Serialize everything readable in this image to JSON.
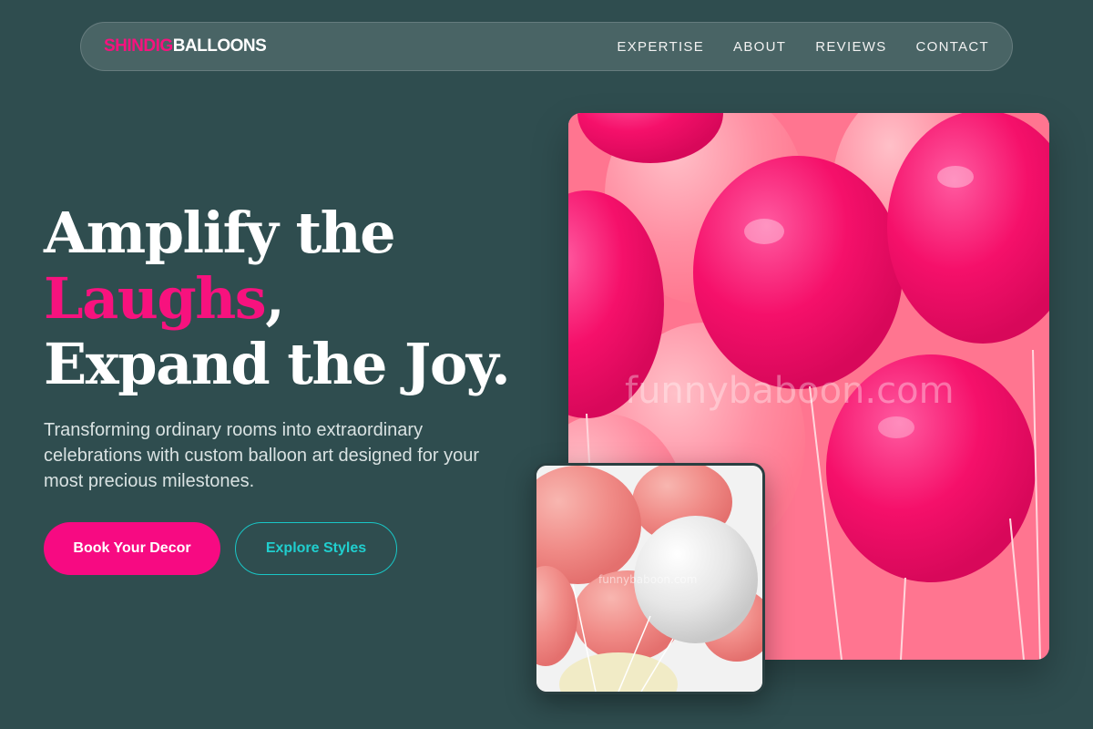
{
  "brand": {
    "part1": "SHINDIG",
    "part2": "BALLOONS"
  },
  "nav": {
    "items": [
      {
        "label": "EXPERTISE"
      },
      {
        "label": "ABOUT"
      },
      {
        "label": "REVIEWS"
      },
      {
        "label": "CONTACT"
      }
    ]
  },
  "hero": {
    "line1": "Amplify the",
    "line2_highlight": "Laughs",
    "line2_suffix": ",",
    "line3": "Expand the Joy.",
    "subtitle": "Transforming ordinary rooms into extraordinary celebrations with custom balloon art designed for your most precious milestones.",
    "primary_button": "Book Your Decor",
    "secondary_button": "Explore Styles"
  },
  "images": {
    "main_watermark": "funnybaboon.com",
    "small_watermark": "funnybaboon.com"
  },
  "colors": {
    "background": "#2f4d4f",
    "accent_pink": "#f70a82",
    "accent_teal": "#19c6c6"
  }
}
